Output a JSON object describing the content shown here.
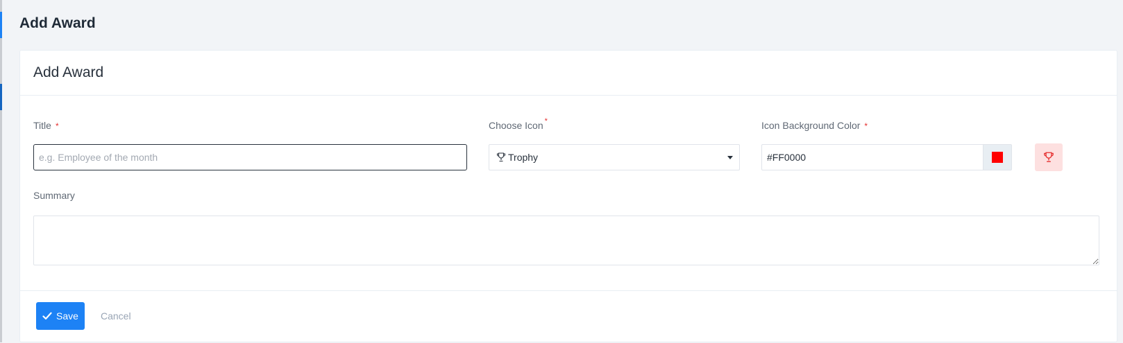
{
  "page": {
    "heading": "Add Award"
  },
  "card": {
    "title": "Add Award"
  },
  "form": {
    "title_field": {
      "label": "Title",
      "required_mark": "*",
      "value": "",
      "placeholder": "e.g. Employee of the month"
    },
    "icon_field": {
      "label": "Choose Icon",
      "required_mark": "*",
      "selected_value": "Trophy",
      "selected_icon": "trophy-icon"
    },
    "color_field": {
      "label": "Icon Background Color",
      "required_mark": "*",
      "value": "#FF0000",
      "swatch_color": "#FF0000"
    },
    "preview": {
      "icon": "trophy-icon",
      "icon_color": "#e52e2e",
      "background": "#fde0e0"
    },
    "summary_field": {
      "label": "Summary",
      "value": ""
    }
  },
  "footer": {
    "save_label": "Save",
    "cancel_label": "Cancel"
  },
  "colors": {
    "accent": "#1d82f5",
    "required": "#e52e2e"
  }
}
